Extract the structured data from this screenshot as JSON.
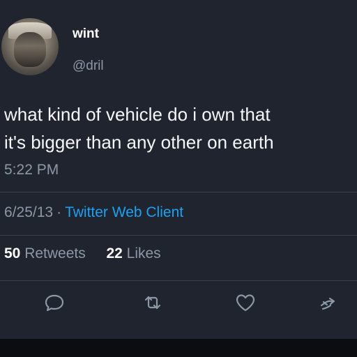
{
  "user": {
    "name": "wint",
    "handle": "@dril"
  },
  "tweet": {
    "line1": "what kind of vehicle do i own that",
    "line2": "it's bigger than any other on earth",
    "time": "5:22 PM",
    "date": "6/25/13",
    "separator": "·",
    "client": "Twitter Web Client"
  },
  "stats": {
    "retweets_count": "50",
    "retweets_label": "Retweets",
    "likes_count": "22",
    "likes_label": "Likes"
  },
  "actions": [
    "reply-icon",
    "retweet-icon",
    "like-icon",
    "share-icon"
  ],
  "colors": {
    "background": "#20242f",
    "muted": "#8b98a5",
    "link": "#1da1f2",
    "divider": "#3a414d"
  }
}
